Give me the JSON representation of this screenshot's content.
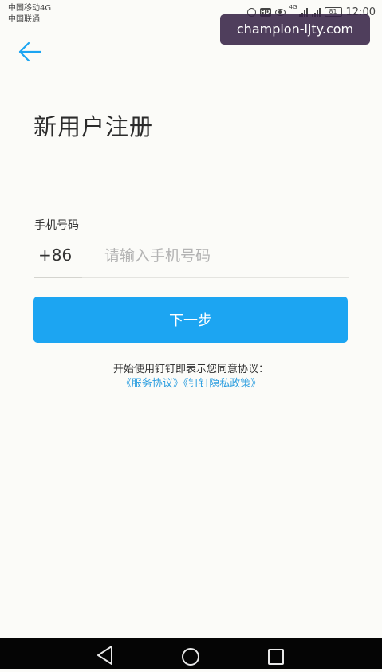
{
  "status_bar": {
    "carrier_1": "中国移动4G",
    "carrier_2": "中国联通",
    "network_label": "4G",
    "battery": "81",
    "time": "12:00"
  },
  "watermark": "champion-ljty.com",
  "header": {
    "back_icon": "arrow-left-icon",
    "title": "新用户注册"
  },
  "form": {
    "phone_label": "手机号码",
    "country_code": "+86",
    "phone_placeholder": "请输入手机号码",
    "next_button": "下一步"
  },
  "agreement": {
    "text": "开始使用钉钉即表示您同意协议：",
    "service_link": "《服务协议》",
    "privacy_link": "《钉钉隐私政策》"
  },
  "nav": {
    "back_icon": "triangle-back-icon",
    "home_icon": "circle-home-icon",
    "recent_icon": "square-recent-icon"
  },
  "colors": {
    "accent": "#1ca5f2",
    "link": "#2e9fe0",
    "background": "#fbfbf8",
    "nav_bar": "#050505"
  }
}
